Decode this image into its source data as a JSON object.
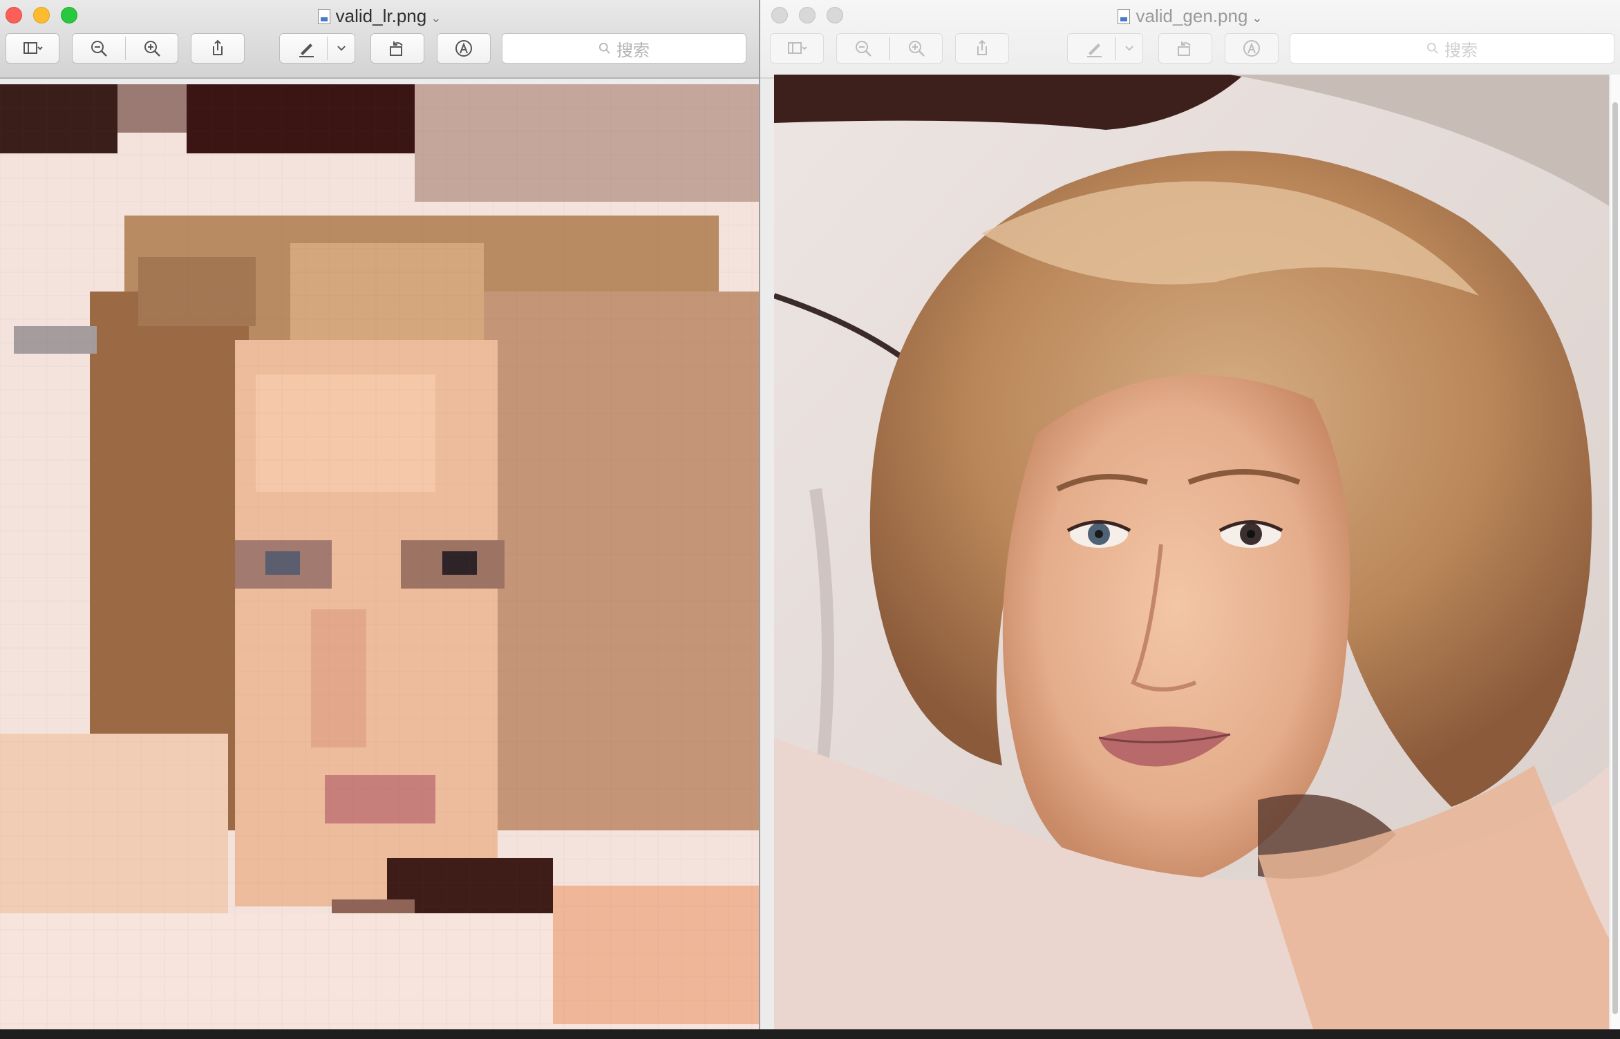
{
  "windows": [
    {
      "id": "left",
      "title": "valid_lr.png",
      "state": "active",
      "search_placeholder": "搜索",
      "content": "pixelated low-resolution portrait of a woman with curly blonde hair"
    },
    {
      "id": "right",
      "title": "valid_gen.png",
      "state": "inactive",
      "search_placeholder": "搜索",
      "content": "upscaled high-resolution portrait of a woman with curly blonde hair"
    }
  ],
  "toolbar_icons": [
    "sidebar-icon",
    "zoom-out-icon",
    "zoom-in-icon",
    "share-icon",
    "markup-pen-icon",
    "rotate-icon",
    "annotate-icon",
    "search-icon"
  ],
  "colors": {
    "close": "#fc5f57",
    "minimize": "#fdbc2e",
    "zoom": "#28c840"
  }
}
